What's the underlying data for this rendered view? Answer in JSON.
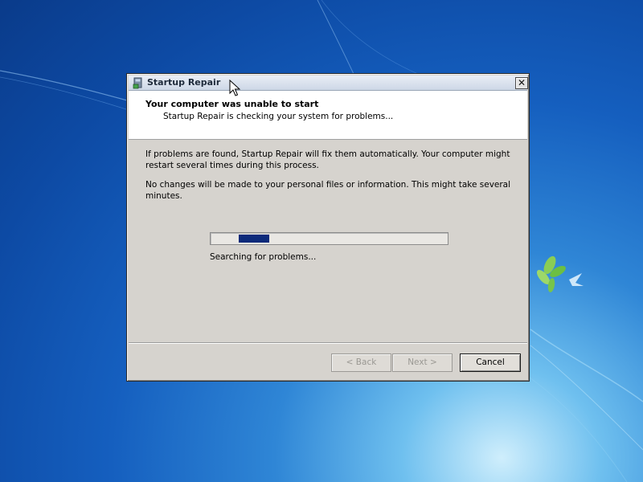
{
  "window": {
    "title": "Startup Repair",
    "close_label": "✕"
  },
  "header": {
    "title": "Your computer was unable to start",
    "subtitle": "Startup Repair is checking your system for problems..."
  },
  "body": {
    "paragraph1": "If problems are found, Startup Repair will fix them automatically. Your computer might restart several times during this process.",
    "paragraph2": "No changes will be made to your personal files or information. This might take several minutes."
  },
  "progress": {
    "status": "Searching for problems...",
    "indeterminate": true
  },
  "buttons": {
    "back": "< Back",
    "next": "Next >",
    "cancel": "Cancel"
  },
  "icons": {
    "title_icon": "startup-repair-icon",
    "close_icon": "close-icon",
    "cursor": "mouse-pointer-icon"
  },
  "colors": {
    "desktop_blue": "#155fbf",
    "dialog_face": "#d6d3ce",
    "progress_fill": "#0c2a7a"
  }
}
